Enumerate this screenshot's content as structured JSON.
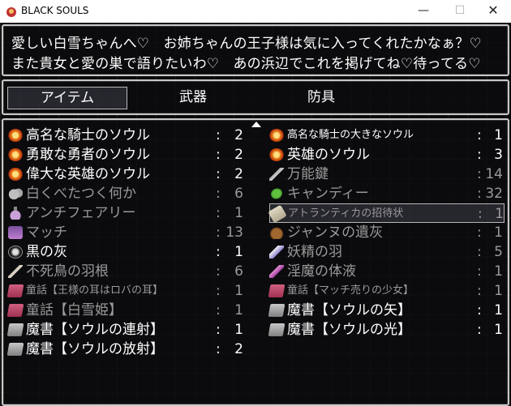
{
  "window": {
    "title": "BLACK SOULS",
    "minimize": "—",
    "maximize": "☐",
    "close": "✕"
  },
  "help": {
    "line1": "愛しい白雪ちゃんへ♡　お姉ちゃんの王子様は気に入ってくれたかなぁ？♡",
    "line2": "また貴女と愛の巣で語りたいわ♡　あの浜辺でこれを掲げてね♡待ってる♡"
  },
  "categories": [
    {
      "label": "アイテム"
    },
    {
      "label": "武器"
    },
    {
      "label": "防具"
    }
  ],
  "items_left": [
    {
      "name": "高名な騎士のソウル",
      "colon": ":",
      "qty": "2",
      "icon": "star-soul-icon",
      "dim": false
    },
    {
      "name": "勇敢な勇者のソウル",
      "colon": ":",
      "qty": "2",
      "icon": "star-soul-icon",
      "dim": false
    },
    {
      "name": "偉大な英雄のソウル",
      "colon": ":",
      "qty": "2",
      "icon": "star-soul-icon",
      "dim": false
    },
    {
      "name": "白くべたつく何か",
      "colon": ":",
      "qty": "6",
      "icon": "cloud-icon",
      "dim": true
    },
    {
      "name": "アンチフェアリー",
      "colon": ":",
      "qty": "1",
      "icon": "bottle-icon",
      "dim": true
    },
    {
      "name": "マッチ",
      "colon": ":",
      "qty": "13",
      "icon": "match-icon",
      "dim": true
    },
    {
      "name": "黒の灰",
      "colon": ":",
      "qty": "1",
      "icon": "ash-icon",
      "dim": false
    },
    {
      "name": "不死鳥の羽根",
      "colon": ":",
      "qty": "6",
      "icon": "feather-icon",
      "dim": true
    },
    {
      "name": "童話【王様の耳はロバの耳】",
      "colon": ":",
      "qty": "1",
      "icon": "red-book-icon",
      "dim": true,
      "small": true
    },
    {
      "name": "童話【白雪姫】",
      "colon": ":",
      "qty": "1",
      "icon": "red-book-icon",
      "dim": true
    },
    {
      "name": "魔書【ソウルの連射】",
      "colon": ":",
      "qty": "1",
      "icon": "grey-book-icon",
      "dim": false
    },
    {
      "name": "魔書【ソウルの放射】",
      "colon": ":",
      "qty": "2",
      "icon": "grey-book-icon",
      "dim": false
    }
  ],
  "items_right": [
    {
      "name": "高名な騎士の大きなソウル",
      "colon": ":",
      "qty": "1",
      "icon": "star-soul-icon",
      "dim": false,
      "small": true
    },
    {
      "name": "英雄のソウル",
      "colon": ":",
      "qty": "3",
      "icon": "star-soul-icon",
      "dim": false
    },
    {
      "name": "万能鍵",
      "colon": ":",
      "qty": "14",
      "icon": "key-icon",
      "dim": true
    },
    {
      "name": "キャンディー",
      "colon": ":",
      "qty": "32",
      "icon": "candy-icon",
      "dim": true
    },
    {
      "name": "アトランティカの招待状",
      "colon": ":",
      "qty": "1",
      "icon": "scroll-icon",
      "dim": true,
      "small": true,
      "selected": true
    },
    {
      "name": "ジャンヌの遺灰",
      "colon": ":",
      "qty": "1",
      "icon": "pouch-icon",
      "dim": true
    },
    {
      "name": "妖精の羽",
      "colon": ":",
      "qty": "5",
      "icon": "wing-icon",
      "dim": true
    },
    {
      "name": "淫魔の体液",
      "colon": ":",
      "qty": "1",
      "icon": "vial-icon",
      "dim": true
    },
    {
      "name": "童話【マッチ売りの少女】",
      "colon": ":",
      "qty": "1",
      "icon": "red-book-icon",
      "dim": true,
      "small": true
    },
    {
      "name": "魔書【ソウルの矢】",
      "colon": ":",
      "qty": "1",
      "icon": "grey-book-icon",
      "dim": false
    },
    {
      "name": "魔書【ソウルの光】",
      "colon": ":",
      "qty": "1",
      "icon": "grey-book-icon",
      "dim": false
    }
  ]
}
